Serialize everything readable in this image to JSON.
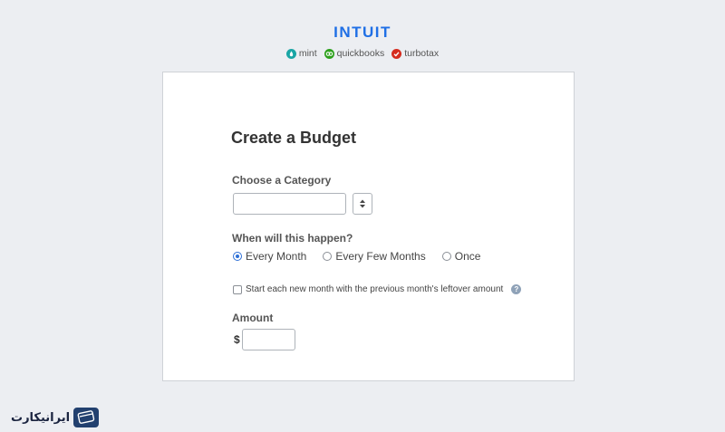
{
  "brand": {
    "logo_text": "INTUIT",
    "products": [
      {
        "name": "mint",
        "color": "#1aa5a5",
        "icon": "mint-icon"
      },
      {
        "name": "quickbooks",
        "color": "#2ca01c",
        "icon": "quickbooks-icon"
      },
      {
        "name": "turbotax",
        "color": "#d52b1e",
        "icon": "turbotax-icon"
      }
    ]
  },
  "form": {
    "title": "Create a Budget",
    "category_label": "Choose a Category",
    "category_value": "",
    "frequency_label": "When will this happen?",
    "frequency_options": [
      "Every Month",
      "Every Few Months",
      "Once"
    ],
    "frequency_selected": "Every Month",
    "rollover_label": "Start each new month with the previous month's leftover amount",
    "rollover_checked": false,
    "help_icon": "?",
    "amount_label": "Amount",
    "currency_symbol": "$",
    "amount_value": ""
  },
  "watermark": {
    "text": "ایرانیکارت"
  },
  "colors": {
    "accent": "#1f6fe5",
    "background": "#eceef2"
  }
}
